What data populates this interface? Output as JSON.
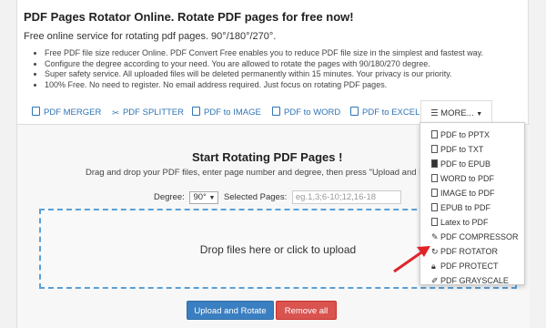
{
  "header": {
    "title": "PDF Pages Rotator Online. Rotate PDF pages for free now!",
    "subtitle": "Free online service for rotating pdf pages. 90°/180°/270°."
  },
  "features": [
    "Free PDF file size reducer Online. PDF Convert Free enables you to reduce PDF file size in the simplest and fastest way.",
    "Configure the degree according to your need. You are allowed to rotate the pages with 90/180/270 degree.",
    "Super safety service. All uploaded files will be deleted permanently within 15 minutes. Your privacy is our priority.",
    "100% Free. No need to register. No email address required. Just focus on rotating PDF pages."
  ],
  "tabs": {
    "merger": "PDF MERGER",
    "splitter": "PDF SPLITTER",
    "to_image": "PDF to IMAGE",
    "to_word": "PDF to WORD",
    "to_excel": "PDF to EXCEL",
    "more": "MORE..."
  },
  "panel": {
    "title": "Start Rotating PDF Pages !",
    "description": "Drag and drop your PDF files, enter page number and degree, then press \"Upload and Rotate\" bu",
    "degree_label": "Degree:",
    "degree_value": "90°",
    "selected_pages_label": "Selected Pages:",
    "pages_placeholder": "eg.1,3;6-10;12,16-18",
    "dropzone_text": "Drop files here or click to upload",
    "upload_button": "Upload and Rotate",
    "remove_button": "Remove all"
  },
  "more_menu": {
    "items": [
      "PDF to PPTX",
      "PDF to TXT",
      "PDF to EPUB",
      "WORD to PDF",
      "IMAGE to PDF",
      "EPUB to PDF",
      "Latex to PDF",
      "PDF COMPRESSOR",
      "PDF ROTATOR",
      "PDF PROTECT",
      "PDF GRAYSCALE"
    ],
    "icons": [
      "file-icon",
      "file-icon",
      "book-icon",
      "file-icon",
      "file-icon",
      "file-icon",
      "file-icon",
      "wrench-icon",
      "rotate-icon",
      "lock-icon",
      "brush-icon"
    ]
  },
  "colors": {
    "link_blue": "#2f74b5",
    "primary_button": "#3a7fc1",
    "danger_button": "#d9534f",
    "arrow_red": "#e0242a",
    "dropzone_border": "#5aa0d8"
  }
}
